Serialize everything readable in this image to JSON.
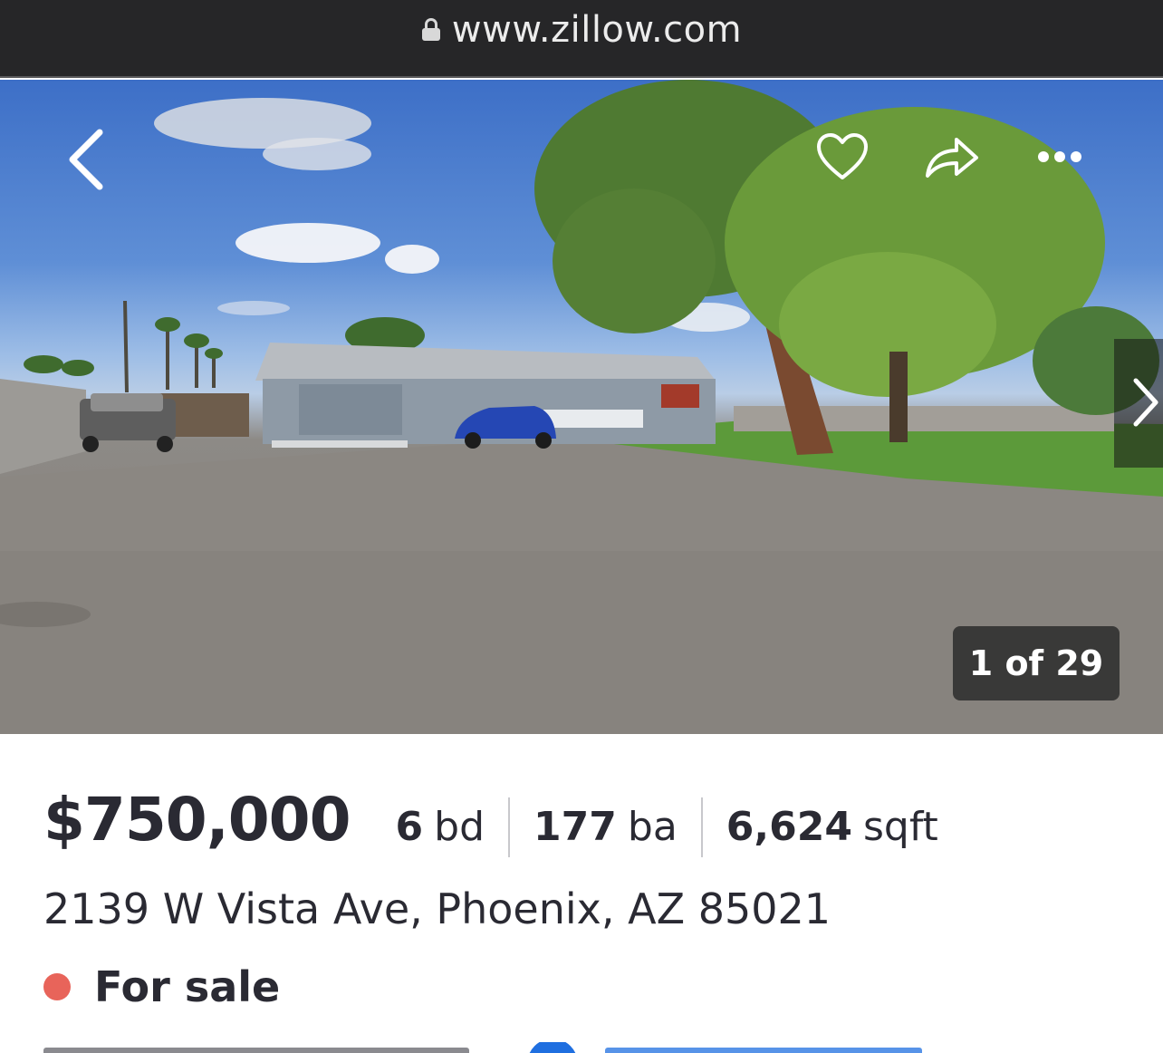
{
  "browser": {
    "url": "www.zillow.com",
    "lock_icon": "lock-icon"
  },
  "gallery": {
    "back_icon": "chevron-left-icon",
    "favorite_icon": "heart-icon",
    "share_icon": "share-arrow-icon",
    "more_icon": "more-dots-icon",
    "next_icon": "chevron-right-icon",
    "counter": "1 of 29"
  },
  "listing": {
    "price": "$750,000",
    "beds_num": "6",
    "beds_unit": "bd",
    "baths_num": "177",
    "baths_unit": "ba",
    "sqft_num": "6,624",
    "sqft_unit": "sqft",
    "address": "2139 W Vista Ave, Phoenix, AZ 85021",
    "status": "For sale",
    "status_color": "#e8645a"
  }
}
